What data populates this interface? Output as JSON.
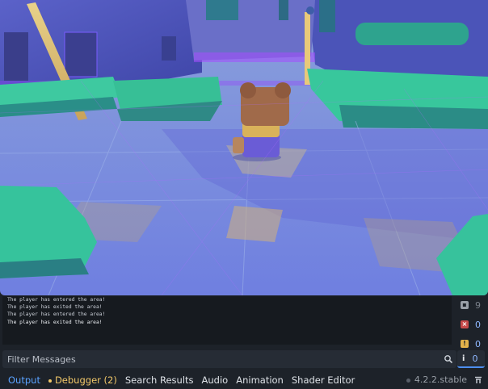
{
  "log": {
    "lines": [
      "The player has entered the area!",
      "The player has exited the area!",
      "The player has entered the area!",
      "The player has exited the area!"
    ]
  },
  "counters": {
    "log_count": "9",
    "error_count": "0",
    "warning_count": "0",
    "info_count": "0"
  },
  "filter": {
    "placeholder": "Filter Messages",
    "value": ""
  },
  "tabs": [
    {
      "label": "Output"
    },
    {
      "label": "Debugger (2)"
    },
    {
      "label": "Search Results"
    },
    {
      "label": "Audio"
    },
    {
      "label": "Animation"
    },
    {
      "label": "Shader Editor"
    }
  ],
  "version": "4.2.2.stable",
  "colors": {
    "accent": "#4d8ff0",
    "debugger": "#f2c869",
    "panel_bg": "#1d2229",
    "wireframe": "#9a3cff"
  },
  "icons": {
    "search": "search-icon",
    "pin": "pin-icon",
    "error": "error-icon",
    "warning": "warning-icon",
    "info": "info-icon"
  }
}
